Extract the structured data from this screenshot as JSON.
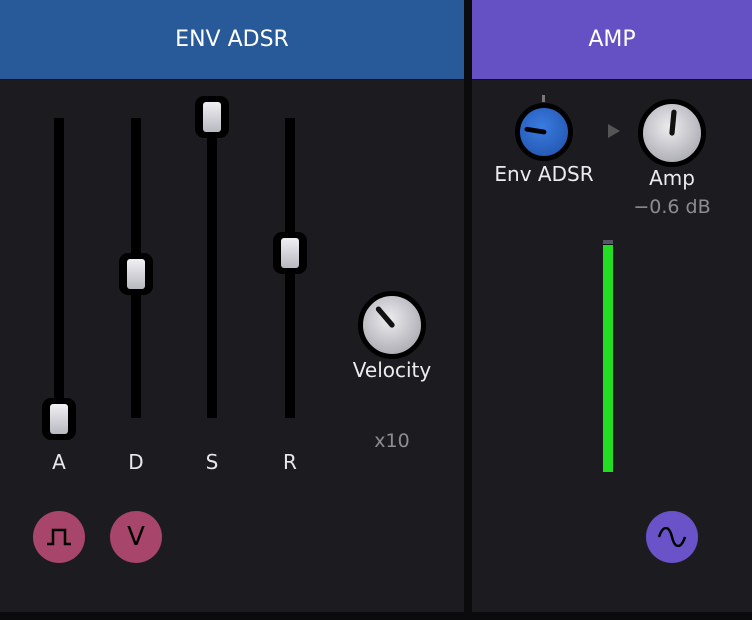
{
  "env": {
    "title": "ENV ADSR",
    "sliders": [
      {
        "label": "A",
        "value": 0.0
      },
      {
        "label": "D",
        "value": 0.48
      },
      {
        "label": "S",
        "value": 1.0
      },
      {
        "label": "R",
        "value": 0.55
      }
    ],
    "velocity": {
      "label": "Velocity",
      "value": 0.35
    },
    "multiplier": "x10",
    "buttons": {
      "gate_icon": "square-pulse-icon",
      "velocity_button": "V"
    }
  },
  "amp": {
    "title": "AMP",
    "env_knob": {
      "label": "Env ADSR",
      "value": 0.2
    },
    "amp_knob": {
      "label": "Amp",
      "value": 0.52,
      "readout": "−0.6 dB"
    },
    "meter_level": 0.98,
    "wave_icon": "sine-wave-icon"
  },
  "colors": {
    "env_header": "#285a9a",
    "amp_header": "#6550c4",
    "env_knob": "#2a62c4",
    "meter": "#22dd22",
    "pink_button": "#a8456a",
    "purple_button": "#6a52c8"
  }
}
